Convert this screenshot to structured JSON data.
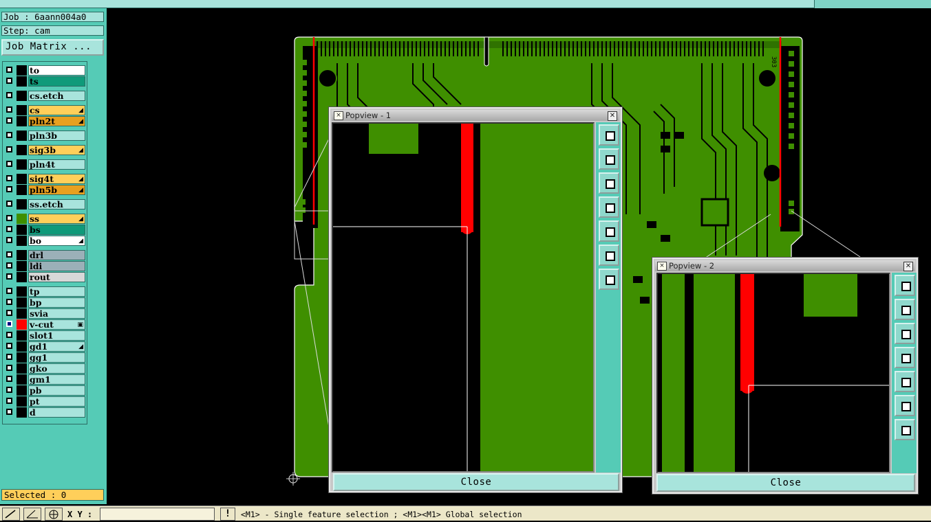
{
  "job": {
    "job_label": "Job : 6aann004a0",
    "step_label": "Step: cam",
    "matrix_button": "Job Matrix ..."
  },
  "layers": [
    {
      "name": "to",
      "bg": "#ffffff",
      "mark": ""
    },
    {
      "name": "ts",
      "bg": "#0f9a7a",
      "mark": ""
    },
    {
      "name": "cs.etch",
      "bg": "#a8e4dc",
      "mark": ""
    },
    {
      "name": "cs",
      "bg": "#ffcf5a",
      "mark": "◢"
    },
    {
      "name": "pln2t",
      "bg": "#e8a020",
      "mark": "◢"
    },
    {
      "name": "pln3b",
      "bg": "#a8e4dc",
      "mark": ""
    },
    {
      "name": "sig3b",
      "bg": "#ffcf5a",
      "mark": "◢"
    },
    {
      "name": "pln4t",
      "bg": "#a8e4dc",
      "mark": ""
    },
    {
      "name": "sig4t",
      "bg": "#ffcf5a",
      "mark": "◢"
    },
    {
      "name": "pln5b",
      "bg": "#e8a020",
      "mark": "◢"
    },
    {
      "name": "ss.etch",
      "bg": "#a8e4dc",
      "mark": ""
    },
    {
      "name": "ss",
      "bg": "#ffcf5a",
      "mark": "◢"
    },
    {
      "name": "bs",
      "bg": "#0f9a7a",
      "mark": ""
    },
    {
      "name": "bo",
      "bg": "#ffffff",
      "mark": "◢"
    },
    {
      "name": "drl",
      "bg": "#9bb0b8",
      "mark": ""
    },
    {
      "name": "ldi",
      "bg": "#9bb0b8",
      "mark": ""
    },
    {
      "name": "rout",
      "bg": "#d8d8d8",
      "mark": ""
    },
    {
      "name": "tp",
      "bg": "#a8e4dc",
      "mark": ""
    },
    {
      "name": "bp",
      "bg": "#a8e4dc",
      "mark": ""
    },
    {
      "name": "svia",
      "bg": "#a8e4dc",
      "mark": ""
    },
    {
      "name": "v-cut",
      "bg": "#a8e4dc",
      "mark": "▣"
    },
    {
      "name": "slot1",
      "bg": "#a8e4dc",
      "mark": ""
    },
    {
      "name": "gd1",
      "bg": "#a8e4dc",
      "mark": "◢"
    },
    {
      "name": "gg1",
      "bg": "#a8e4dc",
      "mark": ""
    },
    {
      "name": "gko",
      "bg": "#a8e4dc",
      "mark": ""
    },
    {
      "name": "gm1",
      "bg": "#a8e4dc",
      "mark": ""
    },
    {
      "name": "pb",
      "bg": "#a8e4dc",
      "mark": ""
    },
    {
      "name": "pt",
      "bg": "#a8e4dc",
      "mark": ""
    },
    {
      "name": "d",
      "bg": "#a8e4dc",
      "mark": ""
    }
  ],
  "selected_label": "Selected : 0",
  "bottom": {
    "xy_label": "X Y :",
    "xy_value": "",
    "warn_icon": "!",
    "status": "<M1> - Single feature selection ; <M1><M1> Global selection"
  },
  "popups": [
    {
      "title": "Popview - 1",
      "close_label": "Close"
    },
    {
      "title": "Popview - 2",
      "close_label": "Close"
    }
  ],
  "board_labels": {
    "right_edge": "303"
  },
  "colors": {
    "pcb_green": "#3f8f00",
    "cut_red": "#ff0000",
    "panel_teal": "#55cbb6"
  }
}
